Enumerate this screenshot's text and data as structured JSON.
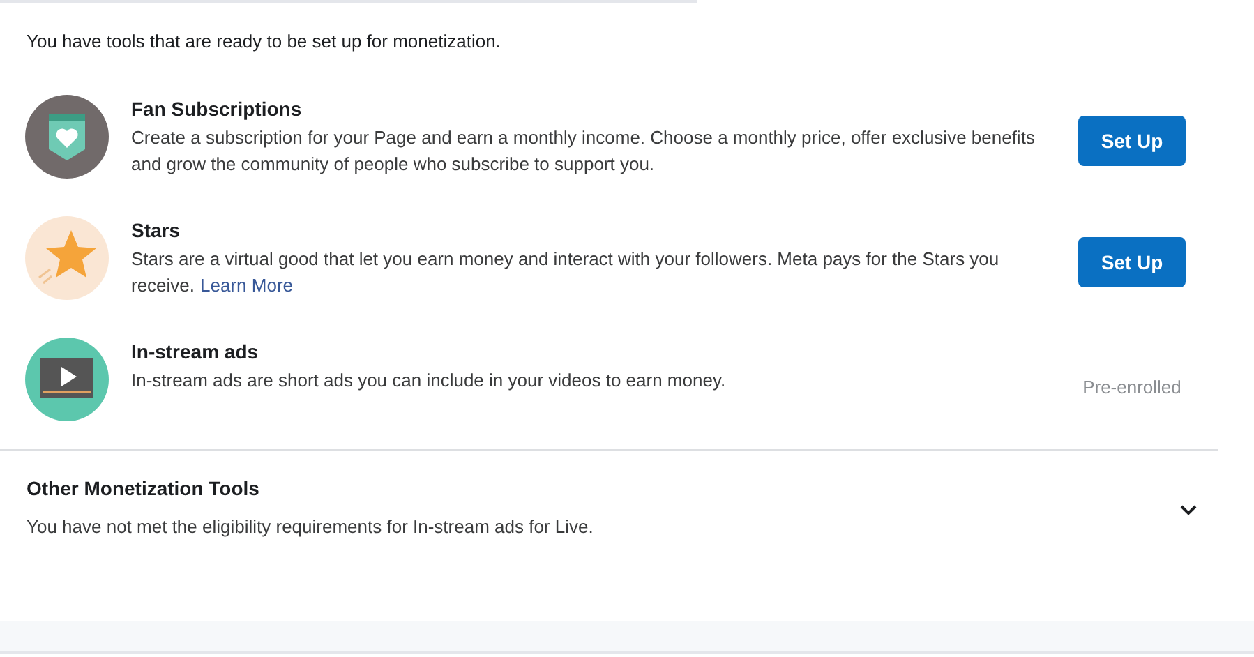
{
  "intro": "You have tools that are ready to be set up for monetization.",
  "tools": [
    {
      "kind": "subscription",
      "title": "Fan Subscriptions",
      "description": "Create a subscription for your Page and earn a monthly income. Choose a monthly price, offer exclusive benefits and grow the community of people who subscribe to support you.",
      "action": {
        "kind": "button",
        "label": "Set Up"
      }
    },
    {
      "kind": "star",
      "title": "Stars",
      "description": "Stars are a virtual good that let you earn money and interact with your followers. Meta pays for the Stars you receive.",
      "link": "Learn More",
      "action": {
        "kind": "button",
        "label": "Set Up"
      }
    },
    {
      "kind": "video",
      "title": "In-stream ads",
      "description": "In-stream ads are short ads you can include in your videos to earn money.",
      "action": {
        "kind": "status",
        "label": "Pre-enrolled"
      }
    }
  ],
  "other": {
    "title": "Other Monetization Tools",
    "description": "You have not met the eligibility requirements for In-stream ads for Live.",
    "expanded": false
  }
}
